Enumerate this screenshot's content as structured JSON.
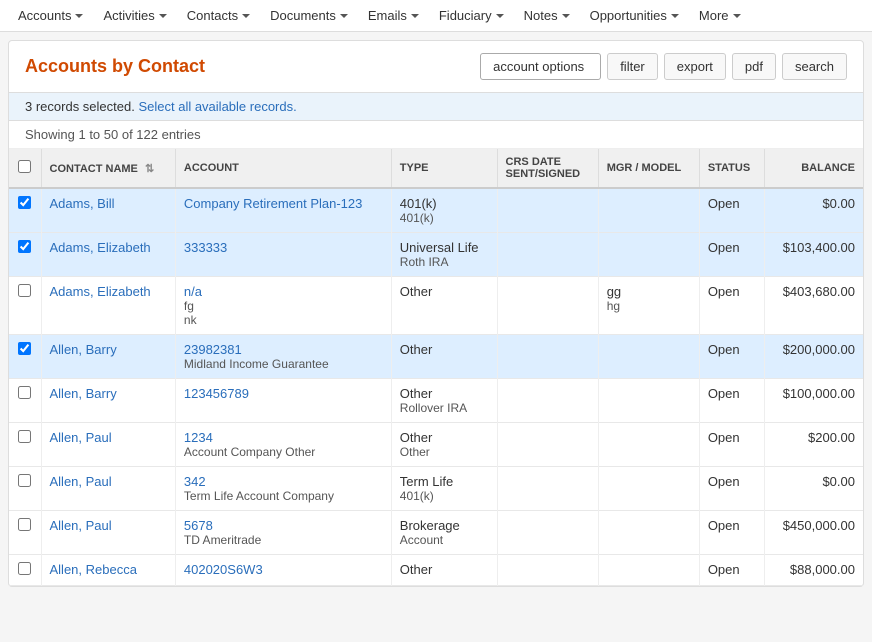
{
  "nav": {
    "items": [
      {
        "label": "Accounts",
        "id": "accounts"
      },
      {
        "label": "Activities",
        "id": "activities"
      },
      {
        "label": "Contacts",
        "id": "contacts"
      },
      {
        "label": "Documents",
        "id": "documents"
      },
      {
        "label": "Emails",
        "id": "emails"
      },
      {
        "label": "Fiduciary",
        "id": "fiduciary"
      },
      {
        "label": "Notes",
        "id": "notes"
      },
      {
        "label": "Opportunities",
        "id": "opportunities"
      },
      {
        "label": "More",
        "id": "more"
      }
    ]
  },
  "header": {
    "title": "Accounts by Contact",
    "buttons": {
      "account_options": "account options",
      "filter": "filter",
      "export": "export",
      "pdf": "pdf",
      "search": "search"
    }
  },
  "info_bar": {
    "selected_text": "3 records selected.",
    "select_link": "Select all available records."
  },
  "entries_bar": {
    "text": "Showing 1 to 50 of 122 entries"
  },
  "table": {
    "columns": [
      {
        "id": "contact_name",
        "label": "Contact Name",
        "sortable": true
      },
      {
        "id": "account",
        "label": "Account"
      },
      {
        "id": "type",
        "label": "Type"
      },
      {
        "id": "crs_date",
        "label": "CRS Date Sent/Signed"
      },
      {
        "id": "mgr_model",
        "label": "MGR / Model"
      },
      {
        "id": "status",
        "label": "Status"
      },
      {
        "id": "balance",
        "label": "Balance"
      }
    ],
    "rows": [
      {
        "id": 1,
        "selected": true,
        "contact": "Adams, Bill",
        "account": "Company Retirement Plan-123",
        "account_sub": "",
        "type": "401(k)",
        "type_sub": "401(k)",
        "crs_date": "",
        "mgr_model": "",
        "mgr_sub": "",
        "status": "Open",
        "balance": "$0.00"
      },
      {
        "id": 2,
        "selected": true,
        "contact": "Adams, Elizabeth",
        "account": "333333",
        "account_sub": "",
        "type": "Universal Life",
        "type_sub": "Roth IRA",
        "crs_date": "",
        "mgr_model": "",
        "mgr_sub": "",
        "status": "Open",
        "balance": "$103,400.00"
      },
      {
        "id": 3,
        "selected": false,
        "contact": "Adams, Elizabeth",
        "account": "n/a",
        "account_sub": "fg\nnk",
        "type": "Other",
        "type_sub": "",
        "crs_date": "",
        "mgr_model": "gg",
        "mgr_sub": "hg",
        "status": "Open",
        "balance": "$403,680.00"
      },
      {
        "id": 4,
        "selected": true,
        "contact": "Allen, Barry",
        "account": "23982381",
        "account_sub": "Midland Income Guarantee",
        "type": "Other",
        "type_sub": "",
        "crs_date": "",
        "mgr_model": "",
        "mgr_sub": "",
        "status": "Open",
        "balance": "$200,000.00"
      },
      {
        "id": 5,
        "selected": false,
        "contact": "Allen, Barry",
        "account": "123456789",
        "account_sub": "",
        "type": "Other",
        "type_sub": "Rollover IRA",
        "crs_date": "",
        "mgr_model": "",
        "mgr_sub": "",
        "status": "Open",
        "balance": "$100,000.00"
      },
      {
        "id": 6,
        "selected": false,
        "contact": "Allen, Paul",
        "account": "1234",
        "account_sub": "Account Company Other",
        "type": "Other",
        "type_sub": "Other",
        "crs_date": "",
        "mgr_model": "",
        "mgr_sub": "",
        "status": "Open",
        "balance": "$200.00"
      },
      {
        "id": 7,
        "selected": false,
        "contact": "Allen, Paul",
        "account": "342",
        "account_sub": "Term Life Account Company",
        "type": "Term Life",
        "type_sub": "401(k)",
        "crs_date": "",
        "mgr_model": "",
        "mgr_sub": "",
        "status": "Open",
        "balance": "$0.00"
      },
      {
        "id": 8,
        "selected": false,
        "contact": "Allen, Paul",
        "account": "5678",
        "account_sub": "TD Ameritrade",
        "type": "Brokerage",
        "type_sub": "Account",
        "crs_date": "",
        "mgr_model": "",
        "mgr_sub": "",
        "status": "Open",
        "balance": "$450,000.00"
      },
      {
        "id": 9,
        "selected": false,
        "contact": "Allen, Rebecca",
        "account": "402020S6W3",
        "account_sub": "",
        "type": "Other",
        "type_sub": "",
        "crs_date": "",
        "mgr_model": "",
        "mgr_sub": "",
        "status": "Open",
        "balance": "$88,000.00"
      }
    ]
  }
}
